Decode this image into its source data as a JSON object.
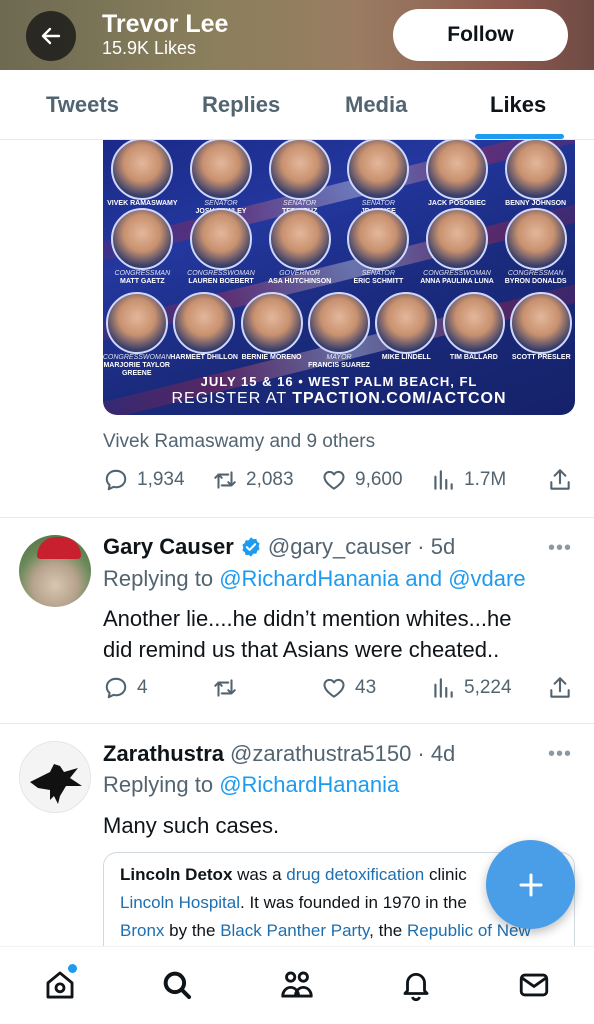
{
  "header": {
    "name": "Trevor Lee",
    "likes": "15.9K Likes",
    "follow_label": "Follow",
    "background_colors": [
      "#6d6a52",
      "#9a7d62",
      "#6e4a44"
    ]
  },
  "tabs": [
    {
      "label": "Tweets",
      "active": false
    },
    {
      "label": "Replies",
      "active": false
    },
    {
      "label": "Media",
      "active": false
    },
    {
      "label": "Likes",
      "active": true
    }
  ],
  "promo": {
    "speakers": [
      {
        "role": "",
        "name": "VIVEK RAMASWAMY"
      },
      {
        "role": "SENATOR",
        "name": "JOSH HAWLEY"
      },
      {
        "role": "SENATOR",
        "name": "TED CRUZ"
      },
      {
        "role": "SENATOR",
        "name": "JD VANCE"
      },
      {
        "role": "",
        "name": "JACK POSOBIEC"
      },
      {
        "role": "",
        "name": "BENNY JOHNSON"
      },
      {
        "role": "CONGRESSMAN",
        "name": "MATT GAETZ"
      },
      {
        "role": "CONGRESSWOMAN",
        "name": "LAUREN BOEBERT"
      },
      {
        "role": "GOVERNOR",
        "name": "ASA HUTCHINSON"
      },
      {
        "role": "SENATOR",
        "name": "ERIC SCHMITT"
      },
      {
        "role": "CONGRESSWOMAN",
        "name": "ANNA PAULINA LUNA"
      },
      {
        "role": "CONGRESSMAN",
        "name": "BYRON DONALDS"
      },
      {
        "role": "CONGRESSWOMAN",
        "name": "MARJORIE TAYLOR GREENE"
      },
      {
        "role": "",
        "name": "HARMEET DHILLON"
      },
      {
        "role": "",
        "name": "BERNIE MORENO"
      },
      {
        "role": "MAYOR",
        "name": "FRANCIS SUAREZ"
      },
      {
        "role": "",
        "name": "MIKE LINDELL"
      },
      {
        "role": "",
        "name": "TIM BALLARD"
      },
      {
        "role": "",
        "name": "SCOTT PRESLER"
      }
    ],
    "date_line": "JULY 15 & 16  •  WEST PALM BEACH, FL",
    "register_prefix": "REGISTER AT ",
    "register_url": "TPACTION.COM/ACTCON"
  },
  "liked_tweet": {
    "liked_by": "Vivek Ramaswamy and 9 others",
    "replies": "1,934",
    "retweets": "2,083",
    "likes": "9,600",
    "views": "1.7M"
  },
  "tweet1": {
    "name": "Gary Causer",
    "handle": "@gary_causer",
    "time": "· 5d",
    "replying_prefix": "Replying to ",
    "replying_to": "@RichardHanania and @vdare",
    "text_line1": "Another lie....he didn’t mention whites...he",
    "text_line2": "did remind us that Asians were cheated..",
    "replies": "4",
    "retweets": "",
    "likes": "43",
    "views": "5,224",
    "more": "•••"
  },
  "tweet2": {
    "name": "Zarathustra",
    "handle": "@zarathustra5150",
    "time": "· 4d",
    "replying_prefix": "Replying to ",
    "replying_to": "@RichardHanania",
    "text": "Many such cases.",
    "more": "•••",
    "card": {
      "title": "Lincoln Detox",
      "t1": " was a ",
      "link1": "drug detoxification",
      "t2": " clinic",
      "link2": "Lincoln Hospital",
      "t3": ". It was founded in 1970 in the ",
      "link3": "Bronx",
      "t4": " by the ",
      "link4": "Black Panther Party",
      "t5": ", the ",
      "link5": "Republic of New"
    }
  },
  "colors": {
    "accent": "#1d9bf0",
    "verified": "#1d9bf0",
    "fab": "#4a9ee8"
  },
  "icons": [
    "back-arrow-icon",
    "reply-icon",
    "retweet-icon",
    "heart-icon",
    "views-icon",
    "share-icon",
    "verified-icon",
    "plus-icon",
    "home-icon",
    "search-icon",
    "communities-icon",
    "bell-icon",
    "mail-icon"
  ]
}
